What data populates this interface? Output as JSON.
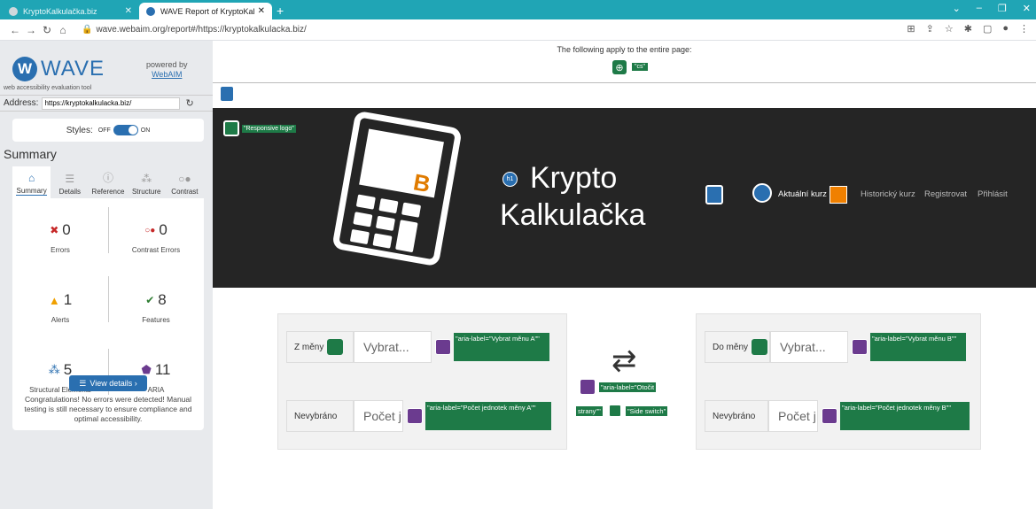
{
  "browser": {
    "tabs": [
      {
        "title": "KryptoKalkulačka.biz"
      },
      {
        "title": "WAVE Report of KryptoKalkulač"
      }
    ],
    "url": "wave.webaim.org/report#/https://kryptokalkulacka.biz/"
  },
  "wave": {
    "logo": "WAVE",
    "tagline": "web accessibility evaluation tool",
    "powered_by": "powered by",
    "webaim": "WebAIM",
    "address_label": "Address:",
    "address_value": "https://kryptokalkulacka.biz/",
    "styles_label": "Styles:",
    "styles_off": "OFF",
    "styles_on": "ON",
    "summary_heading": "Summary",
    "tabs": [
      "Summary",
      "Details",
      "Reference",
      "Structure",
      "Contrast"
    ],
    "counts": {
      "errors": {
        "value": "0",
        "label": "Errors"
      },
      "contrast": {
        "value": "0",
        "label": "Contrast Errors"
      },
      "alerts": {
        "value": "1",
        "label": "Alerts"
      },
      "features": {
        "value": "8",
        "label": "Features"
      },
      "structural": {
        "value": "5",
        "label": "Structural Elements"
      },
      "aria": {
        "value": "11",
        "label": "ARIA"
      }
    },
    "view_details": "View details ›",
    "congrats": "Congratulations! No errors were detected! Manual testing is still necessary to ensure compliance and optimal accessibility."
  },
  "page": {
    "notice": "The following apply to the entire page:",
    "lang_tag": "\"cs\"",
    "responsive_logo": "\"Responsive logo\"",
    "title_line1": "Krypto",
    "title_line2": "Kalkulačka",
    "nav": [
      "Aktuální kurz",
      "Historický kurz",
      "Registrovat",
      "Přihlásit"
    ],
    "left": {
      "from_label": "Z měny",
      "from_placeholder": "Vybrat...",
      "from_aria": "\"aria-label=\"Vybrat měnu A\"\"",
      "amount_label": "Nevybráno",
      "amount_placeholder": "Počet j",
      "amount_aria": "\"aria-label=\"Počet jednotek měny A\"\""
    },
    "right": {
      "to_label": "Do měny",
      "to_placeholder": "Vybrat...",
      "to_aria": "\"aria-label=\"Vybrat měnu B\"\"",
      "amount_label": "Nevybráno",
      "amount_placeholder": "Počet j",
      "amount_aria": "\"aria-label=\"Počet jednotek měny B\"\""
    },
    "swap_aria_1": "\"aria-label=\"Otočit",
    "swap_aria_2": "strany\"\"",
    "side_switch": "\"Side switch\""
  }
}
